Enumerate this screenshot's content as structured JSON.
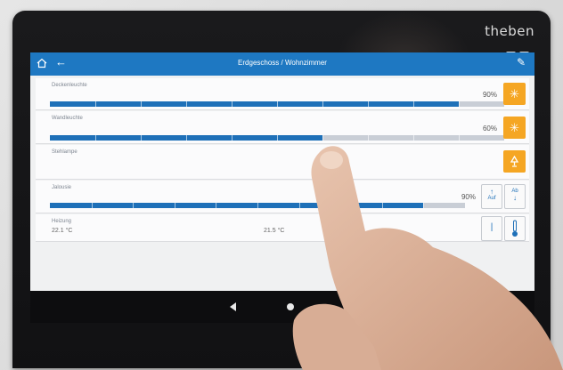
{
  "brand": "theben",
  "appbar": {
    "title": "Erdgeschoss / Wohnzimmer",
    "home_icon": "home-icon",
    "back_icon": "arrow-left-icon",
    "edit_icon": "pencil-icon"
  },
  "rows": {
    "decke": {
      "label": "Deckenleuchte",
      "percent": "90%",
      "level": 0.9,
      "icon": "light-dimmer-icon"
    },
    "wand": {
      "label": "Wandleuchte",
      "percent": "60%",
      "level": 0.6,
      "icon": "light-dimmer-icon"
    },
    "steh": {
      "label": "Stehlampe",
      "icon": "lamp-icon"
    },
    "jalousie": {
      "label": "Jalousie",
      "percent": "90%",
      "level": 0.9,
      "up_label": "Auf",
      "down_label": "Ab"
    },
    "heizung": {
      "label": "Heizung",
      "actual": "22.1 °C",
      "setpoint": "21.5 °C",
      "icon": "thermometer-icon"
    }
  },
  "colors": {
    "accent": "#1e78c2",
    "button": "#f5a623",
    "track": "#c9ced6"
  },
  "navbar": {
    "back_icon": "nav-back-icon",
    "home_icon": "nav-home-icon",
    "recent_icon": "nav-recent-icon"
  }
}
